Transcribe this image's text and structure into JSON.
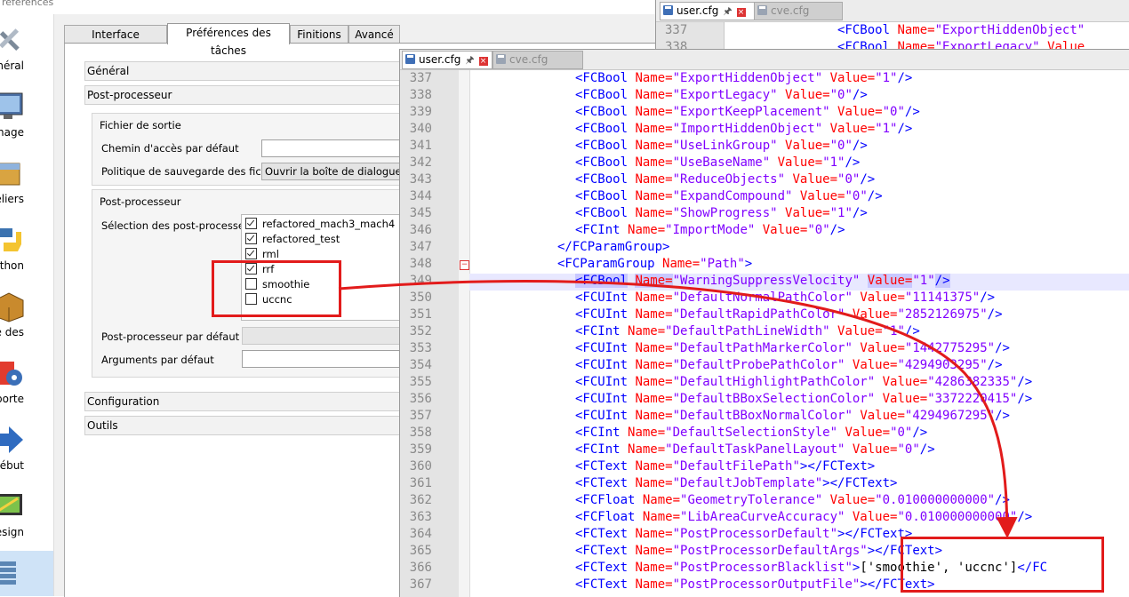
{
  "dialog": {
    "title": "références",
    "categories": [
      {
        "label": "énéral",
        "icon": "wrench-screwdriver-icon"
      },
      {
        "label": "chage",
        "icon": "monitor-icon"
      },
      {
        "label": "eliers",
        "icon": "workbench-box-icon"
      },
      {
        "label": "thon",
        "icon": "python-icon"
      },
      {
        "label": "naire des",
        "icon": "addon-manager-box-icon"
      },
      {
        "label": "r/Exporte",
        "icon": "import-export-gear-icon"
      },
      {
        "label": "ébut",
        "icon": "start-arrow-icon"
      },
      {
        "label": "rt Design",
        "icon": "part-design-icon"
      },
      {
        "label": "",
        "icon": "path-workbench-icon"
      }
    ],
    "tabs": [
      "Interface graphique",
      "Préférences des tâches",
      "Finitions",
      "Avancé"
    ],
    "active_tab": 1,
    "sections": {
      "general": "Général",
      "postprocessor": "Post-processeur",
      "configuration": "Configuration",
      "tools": "Outils"
    },
    "output_group": {
      "title": "Fichier de sortie",
      "default_path_label": "Chemin d'accès par défaut",
      "default_path_value": "",
      "save_policy_label": "Politique de sauvegarde des fichiers",
      "save_policy_value": "Ouvrir la boîte de dialogue de fi"
    },
    "pp_group": {
      "title": "Post-processeur",
      "selection_label": "Sélection des post-processeurs",
      "items": [
        {
          "label": "refactored_mach3_mach4",
          "checked": true
        },
        {
          "label": "refactored_test",
          "checked": true
        },
        {
          "label": "rml",
          "checked": true
        },
        {
          "label": "rrf",
          "checked": true
        },
        {
          "label": "smoothie",
          "checked": false
        },
        {
          "label": "uccnc",
          "checked": false
        }
      ],
      "default_label": "Post-processeur par défaut",
      "args_label": "Arguments par défaut"
    }
  },
  "back_editor": {
    "tabs": [
      {
        "label": "user.cfg",
        "active": true
      },
      {
        "label": "cve.cfg",
        "active": false
      }
    ],
    "lines": [
      {
        "num": "337",
        "tag": "<FCBool",
        "name_attr": "Name=",
        "name_val": "\"ExportHiddenObject\""
      },
      {
        "num": "338",
        "tag": "<FCBool",
        "name_attr": "Name=",
        "name_val": "\"ExportLegacy\"",
        "value_attr": "Value"
      }
    ]
  },
  "editor": {
    "tabs": [
      {
        "label": "user.cfg",
        "active": true
      },
      {
        "label": "cve.cfg",
        "active": false
      }
    ],
    "current_line": "349",
    "lines": [
      {
        "num": "337",
        "segs": [
          [
            "tg",
            "<FCBool "
          ],
          [
            "at",
            "Name="
          ],
          [
            "vl",
            "\"ExportHiddenObject\""
          ],
          [
            "at",
            " Value="
          ],
          [
            "vl",
            "\"1\""
          ],
          [
            "tg",
            "/>"
          ]
        ]
      },
      {
        "num": "338",
        "segs": [
          [
            "tg",
            "<FCBool "
          ],
          [
            "at",
            "Name="
          ],
          [
            "vl",
            "\"ExportLegacy\""
          ],
          [
            "at",
            " Value="
          ],
          [
            "vl",
            "\"0\""
          ],
          [
            "tg",
            "/>"
          ]
        ]
      },
      {
        "num": "339",
        "segs": [
          [
            "tg",
            "<FCBool "
          ],
          [
            "at",
            "Name="
          ],
          [
            "vl",
            "\"ExportKeepPlacement\""
          ],
          [
            "at",
            " Value="
          ],
          [
            "vl",
            "\"0\""
          ],
          [
            "tg",
            "/>"
          ]
        ]
      },
      {
        "num": "340",
        "segs": [
          [
            "tg",
            "<FCBool "
          ],
          [
            "at",
            "Name="
          ],
          [
            "vl",
            "\"ImportHiddenObject\""
          ],
          [
            "at",
            " Value="
          ],
          [
            "vl",
            "\"1\""
          ],
          [
            "tg",
            "/>"
          ]
        ]
      },
      {
        "num": "341",
        "segs": [
          [
            "tg",
            "<FCBool "
          ],
          [
            "at",
            "Name="
          ],
          [
            "vl",
            "\"UseLinkGroup\""
          ],
          [
            "at",
            " Value="
          ],
          [
            "vl",
            "\"0\""
          ],
          [
            "tg",
            "/>"
          ]
        ]
      },
      {
        "num": "342",
        "segs": [
          [
            "tg",
            "<FCBool "
          ],
          [
            "at",
            "Name="
          ],
          [
            "vl",
            "\"UseBaseName\""
          ],
          [
            "at",
            " Value="
          ],
          [
            "vl",
            "\"1\""
          ],
          [
            "tg",
            "/>"
          ]
        ]
      },
      {
        "num": "343",
        "segs": [
          [
            "tg",
            "<FCBool "
          ],
          [
            "at",
            "Name="
          ],
          [
            "vl",
            "\"ReduceObjects\""
          ],
          [
            "at",
            " Value="
          ],
          [
            "vl",
            "\"0\""
          ],
          [
            "tg",
            "/>"
          ]
        ]
      },
      {
        "num": "344",
        "segs": [
          [
            "tg",
            "<FCBool "
          ],
          [
            "at",
            "Name="
          ],
          [
            "vl",
            "\"ExpandCompound\""
          ],
          [
            "at",
            " Value="
          ],
          [
            "vl",
            "\"0\""
          ],
          [
            "tg",
            "/>"
          ]
        ]
      },
      {
        "num": "345",
        "segs": [
          [
            "tg",
            "<FCBool "
          ],
          [
            "at",
            "Name="
          ],
          [
            "vl",
            "\"ShowProgress\""
          ],
          [
            "at",
            " Value="
          ],
          [
            "vl",
            "\"1\""
          ],
          [
            "tg",
            "/>"
          ]
        ]
      },
      {
        "num": "346",
        "segs": [
          [
            "tg",
            "<FCInt "
          ],
          [
            "at",
            "Name="
          ],
          [
            "vl",
            "\"ImportMode\""
          ],
          [
            "at",
            " Value="
          ],
          [
            "vl",
            "\"0\""
          ],
          [
            "tg",
            "/>"
          ]
        ]
      },
      {
        "num": "347",
        "indent": 1,
        "segs": [
          [
            "tg",
            "</FCParamGroup>"
          ]
        ]
      },
      {
        "num": "348",
        "indent": 1,
        "fold": true,
        "segs": [
          [
            "tg",
            "<FCParamGroup "
          ],
          [
            "at",
            "Name="
          ],
          [
            "vl",
            "\"Path\""
          ],
          [
            "tg",
            ">"
          ]
        ]
      },
      {
        "num": "349",
        "current": true,
        "segs": [
          [
            "tghl",
            "<FCBool"
          ],
          [
            "tg",
            " "
          ],
          [
            "athl",
            "Name="
          ],
          [
            "vl",
            "\"WarningSuppressVelocity\""
          ],
          [
            "at",
            " "
          ],
          [
            "athl",
            "Value="
          ],
          [
            "vl",
            "\"1\""
          ],
          [
            "tghl",
            "/>"
          ]
        ]
      },
      {
        "num": "350",
        "segs": [
          [
            "tg",
            "<FCUInt "
          ],
          [
            "at",
            "Name="
          ],
          [
            "vl",
            "\"DefaultNormalPathColor\""
          ],
          [
            "at",
            " Value="
          ],
          [
            "vl",
            "\"11141375\""
          ],
          [
            "tg",
            "/>"
          ]
        ]
      },
      {
        "num": "351",
        "segs": [
          [
            "tg",
            "<FCUInt "
          ],
          [
            "at",
            "Name="
          ],
          [
            "vl",
            "\"DefaultRapidPathColor\""
          ],
          [
            "at",
            " Value="
          ],
          [
            "vl",
            "\"2852126975\""
          ],
          [
            "tg",
            "/>"
          ]
        ]
      },
      {
        "num": "352",
        "segs": [
          [
            "tg",
            "<FCInt "
          ],
          [
            "at",
            "Name="
          ],
          [
            "vl",
            "\"DefaultPathLineWidth\""
          ],
          [
            "at",
            " Value="
          ],
          [
            "vl",
            "\"1\""
          ],
          [
            "tg",
            "/>"
          ]
        ]
      },
      {
        "num": "353",
        "segs": [
          [
            "tg",
            "<FCUInt "
          ],
          [
            "at",
            "Name="
          ],
          [
            "vl",
            "\"DefaultPathMarkerColor\""
          ],
          [
            "at",
            " Value="
          ],
          [
            "vl",
            "\"1442775295\""
          ],
          [
            "tg",
            "/>"
          ]
        ]
      },
      {
        "num": "354",
        "segs": [
          [
            "tg",
            "<FCUInt "
          ],
          [
            "at",
            "Name="
          ],
          [
            "vl",
            "\"DefaultProbePathColor\""
          ],
          [
            "at",
            " Value="
          ],
          [
            "vl",
            "\"4294903295\""
          ],
          [
            "tg",
            "/>"
          ]
        ]
      },
      {
        "num": "355",
        "segs": [
          [
            "tg",
            "<FCUInt "
          ],
          [
            "at",
            "Name="
          ],
          [
            "vl",
            "\"DefaultHighlightPathColor\""
          ],
          [
            "at",
            " Value="
          ],
          [
            "vl",
            "\"4286382335\""
          ],
          [
            "tg",
            "/>"
          ]
        ]
      },
      {
        "num": "356",
        "segs": [
          [
            "tg",
            "<FCUInt "
          ],
          [
            "at",
            "Name="
          ],
          [
            "vl",
            "\"DefaultBBoxSelectionColor\""
          ],
          [
            "at",
            " Value="
          ],
          [
            "vl",
            "\"3372220415\""
          ],
          [
            "tg",
            "/>"
          ]
        ]
      },
      {
        "num": "357",
        "segs": [
          [
            "tg",
            "<FCUInt "
          ],
          [
            "at",
            "Name="
          ],
          [
            "vl",
            "\"DefaultBBoxNormalColor\""
          ],
          [
            "at",
            " Value="
          ],
          [
            "vl",
            "\"4294967295\""
          ],
          [
            "tg",
            "/>"
          ]
        ]
      },
      {
        "num": "358",
        "segs": [
          [
            "tg",
            "<FCInt "
          ],
          [
            "at",
            "Name="
          ],
          [
            "vl",
            "\"DefaultSelectionStyle\""
          ],
          [
            "at",
            " Value="
          ],
          [
            "vl",
            "\"0\""
          ],
          [
            "tg",
            "/>"
          ]
        ]
      },
      {
        "num": "359",
        "segs": [
          [
            "tg",
            "<FCInt "
          ],
          [
            "at",
            "Name="
          ],
          [
            "vl",
            "\"DefaultTaskPanelLayout\""
          ],
          [
            "at",
            " Value="
          ],
          [
            "vl",
            "\"0\""
          ],
          [
            "tg",
            "/>"
          ]
        ]
      },
      {
        "num": "360",
        "segs": [
          [
            "tg",
            "<FCText "
          ],
          [
            "at",
            "Name="
          ],
          [
            "vl",
            "\"DefaultFilePath\""
          ],
          [
            "tg",
            "></FCText>"
          ]
        ]
      },
      {
        "num": "361",
        "segs": [
          [
            "tg",
            "<FCText "
          ],
          [
            "at",
            "Name="
          ],
          [
            "vl",
            "\"DefaultJobTemplate\""
          ],
          [
            "tg",
            "></FCText>"
          ]
        ]
      },
      {
        "num": "362",
        "segs": [
          [
            "tg",
            "<FCFloat "
          ],
          [
            "at",
            "Name="
          ],
          [
            "vl",
            "\"GeometryTolerance\""
          ],
          [
            "at",
            " Value="
          ],
          [
            "vl",
            "\"0.010000000000\""
          ],
          [
            "tg",
            "/>"
          ]
        ]
      },
      {
        "num": "363",
        "segs": [
          [
            "tg",
            "<FCFloat "
          ],
          [
            "at",
            "Name="
          ],
          [
            "vl",
            "\"LibAreaCurveAccuracy\""
          ],
          [
            "at",
            " Value="
          ],
          [
            "vl",
            "\"0.010000000000\""
          ],
          [
            "tg",
            "/>"
          ]
        ]
      },
      {
        "num": "364",
        "segs": [
          [
            "tg",
            "<FCText "
          ],
          [
            "at",
            "Name="
          ],
          [
            "vl",
            "\"PostProcessorDefault\""
          ],
          [
            "tg",
            "></FCText>"
          ]
        ]
      },
      {
        "num": "365",
        "segs": [
          [
            "tg",
            "<FCText "
          ],
          [
            "at",
            "Name="
          ],
          [
            "vl",
            "\"PostProcessorDefaultArgs\""
          ],
          [
            "tg",
            "></FCText>"
          ]
        ]
      },
      {
        "num": "366",
        "segs": [
          [
            "tg",
            "<FCText "
          ],
          [
            "at",
            "Name="
          ],
          [
            "vl",
            "\"PostProcessorBlacklist\""
          ],
          [
            "tg",
            ">"
          ],
          [
            "tx",
            "['smoothie', 'uccnc']"
          ],
          [
            "tg",
            "</FC"
          ]
        ]
      },
      {
        "num": "367",
        "segs": [
          [
            "tg",
            "<FCText "
          ],
          [
            "at",
            "Name="
          ],
          [
            "vl",
            "\"PostProcessorOutputFile\""
          ],
          [
            "tg",
            "></FCText>"
          ]
        ]
      }
    ]
  },
  "annotation": {
    "color": "#e21b1b"
  }
}
